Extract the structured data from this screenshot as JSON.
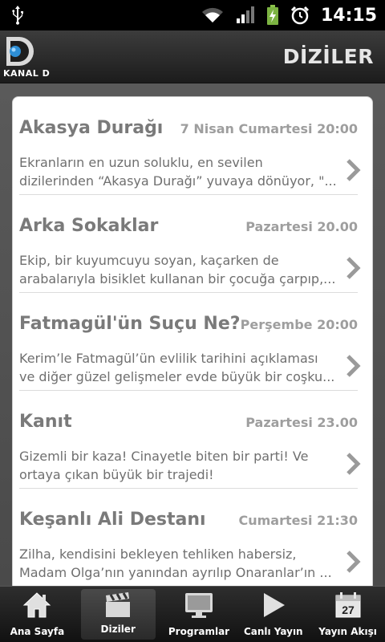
{
  "status_bar": {
    "time": "14:15"
  },
  "header": {
    "logo_text": "KANAL D",
    "title": "DİZİLER"
  },
  "list": [
    {
      "title": "Akasya Durağı",
      "time": "7 Nisan Cumartesi 20:00",
      "desc_line1": "Ekranların en uzun soluklu, en sevilen",
      "desc_line2": "dizilerinden “Akasya Durağı” yuvaya dönüyor, \"..."
    },
    {
      "title": "Arka Sokaklar",
      "time": "Pazartesi 20.00",
      "desc_line1": "Ekip, bir kuyumcuyu soyan, kaçarken de",
      "desc_line2": "arabalarıyla bisiklet kullanan bir çocuğa çarpıp,..."
    },
    {
      "title": "Fatmagül'ün Suçu Ne?",
      "time": "Perşembe 20:00",
      "desc_line1": "Kerim’le Fatmagül’ün evlilik tarihini açıklaması",
      "desc_line2": "ve diğer güzel gelişmeler evde büyük bir coşku..."
    },
    {
      "title": "Kanıt",
      "time": "Pazartesi 23.00",
      "desc_line1": "Gizemli bir kaza! Cinayetle biten bir parti! Ve",
      "desc_line2": "ortaya çıkan büyük bir trajedi!"
    },
    {
      "title": "Keşanlı Ali Destanı",
      "time": "Cumartesi 21:30",
      "desc_line1": "Zilha, kendisini bekleyen tehliken habersiz,",
      "desc_line2": "Madam Olga’nın yanından ayrılıp Onaranlar’ın ..."
    }
  ],
  "tabs": [
    {
      "label": "Ana Sayfa",
      "icon": "home-icon"
    },
    {
      "label": "Diziler",
      "icon": "clapperboard-icon"
    },
    {
      "label": "Programlar",
      "icon": "monitor-icon"
    },
    {
      "label": "Canlı Yayın",
      "icon": "play-icon"
    },
    {
      "label": "Yayın Akışı",
      "icon": "calendar-icon",
      "calendar_day": "27"
    }
  ]
}
